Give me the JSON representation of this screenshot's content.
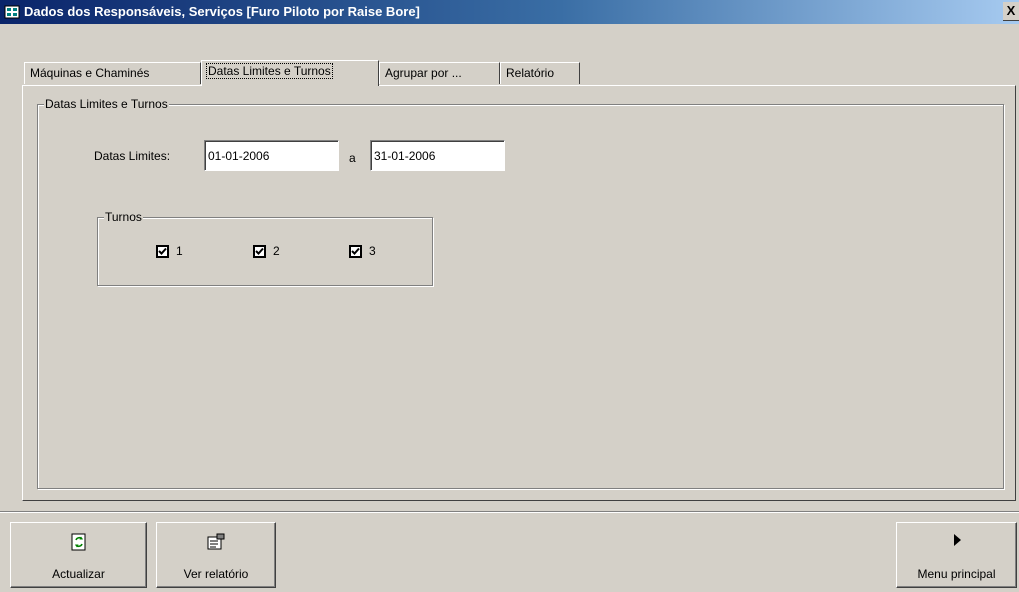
{
  "window": {
    "title": "Dados dos Responsáveis, Serviços [Furo Piloto por Raise Bore]",
    "close_label": "X"
  },
  "tabs": [
    {
      "label": "Máquinas e Chaminés",
      "active": false
    },
    {
      "label": "Datas Limites e Turnos",
      "active": true
    },
    {
      "label": "Agrupar por ...",
      "active": false
    },
    {
      "label": "Relatório",
      "active": false
    }
  ],
  "datas_group": {
    "legend": "Datas Limites e Turnos",
    "datas_label": "Datas Limites:",
    "date_from": "01-01-2006",
    "separator": "a",
    "date_to": "31-01-2006"
  },
  "turnos_group": {
    "legend": "Turnos",
    "shifts": [
      {
        "label": "1",
        "checked": true
      },
      {
        "label": "2",
        "checked": true
      },
      {
        "label": "3",
        "checked": true
      }
    ]
  },
  "buttons": {
    "actualizar": {
      "label": "Actualizar",
      "icon": "refresh-icon"
    },
    "ver_relatorio": {
      "label": "Ver relatório",
      "icon": "report-icon"
    },
    "menu_principal": {
      "label": "Menu principal",
      "icon": "play-arrow-icon"
    }
  },
  "colors": {
    "title_gradient_start": "#0a246a",
    "title_gradient_end": "#a6caf0",
    "face": "#d4d0c8"
  }
}
